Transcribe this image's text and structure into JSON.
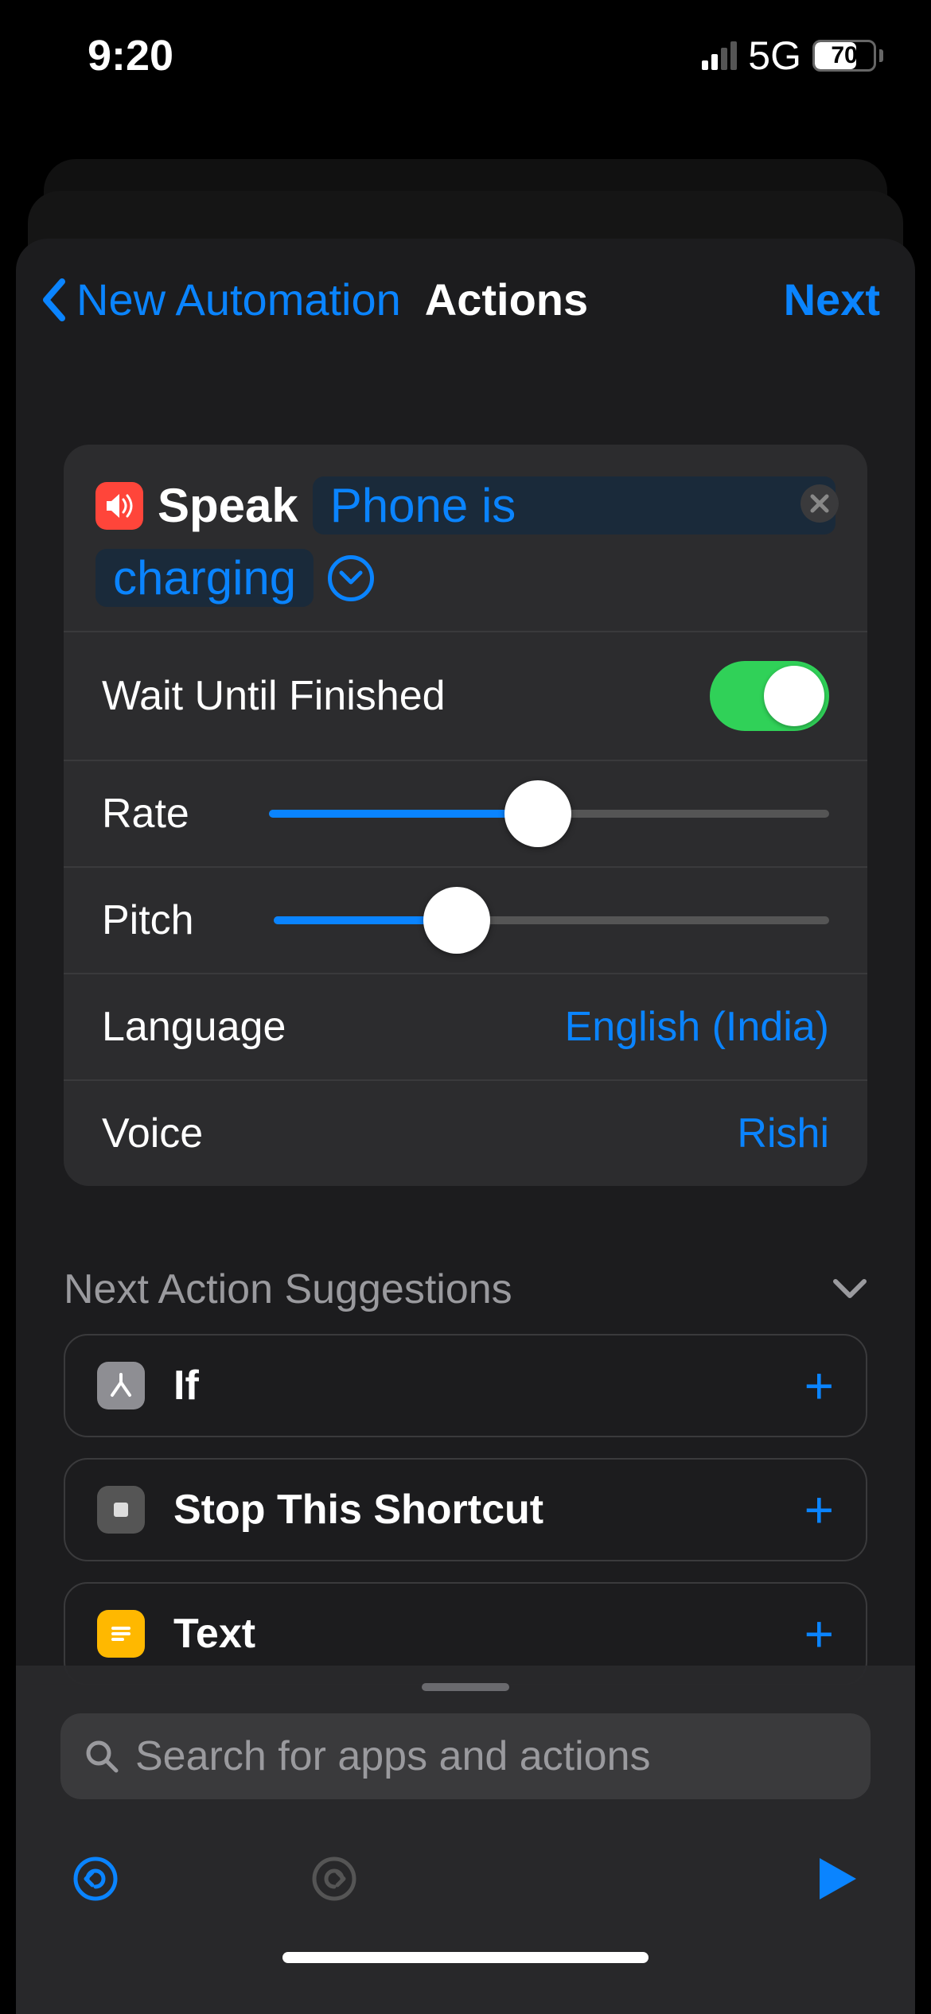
{
  "status": {
    "time": "9:20",
    "network": "5G",
    "battery": 70
  },
  "nav": {
    "back": "New Automation",
    "title": "Actions",
    "next": "Next"
  },
  "action": {
    "icon": "speaker-icon",
    "name": "Speak",
    "text": "Phone is charging",
    "text_part1": "Phone is",
    "text_part2": "charging",
    "settings": {
      "waitUntilFinished": {
        "label": "Wait Until Finished",
        "value": true
      },
      "rate": {
        "label": "Rate",
        "percent": 48
      },
      "pitch": {
        "label": "Pitch",
        "percent": 33
      },
      "language": {
        "label": "Language",
        "value": "English (India)"
      },
      "voice": {
        "label": "Voice",
        "value": "Rishi"
      }
    }
  },
  "suggestions": {
    "title": "Next Action Suggestions",
    "items": [
      {
        "icon": "branch-icon",
        "label": "If"
      },
      {
        "icon": "stop-icon",
        "label": "Stop This Shortcut"
      },
      {
        "icon": "text-icon",
        "label": "Text"
      }
    ]
  },
  "search": {
    "placeholder": "Search for apps and actions"
  }
}
